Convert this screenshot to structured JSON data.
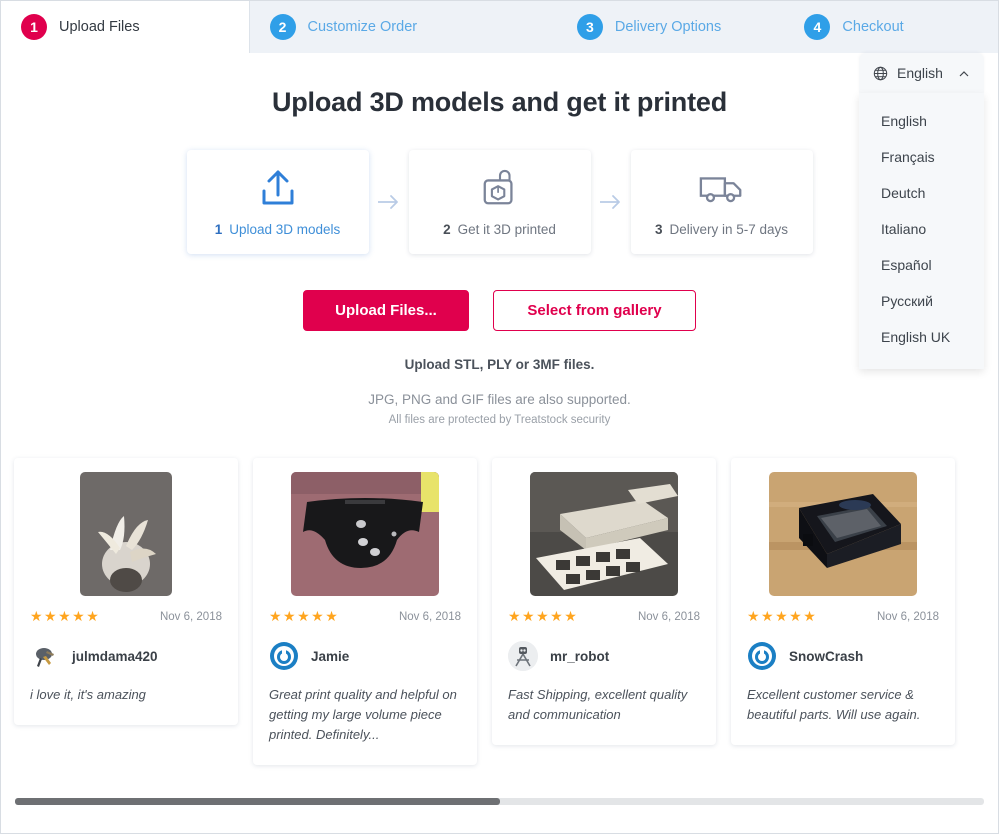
{
  "steps": [
    {
      "num": "1",
      "label": "Upload Files",
      "active": true
    },
    {
      "num": "2",
      "label": "Customize Order",
      "active": false
    },
    {
      "num": "3",
      "label": "Delivery Options",
      "active": false
    },
    {
      "num": "4",
      "label": "Checkout",
      "active": false
    }
  ],
  "language": {
    "selected": "English",
    "globe_icon": "globe-icon",
    "chevron_icon": "chevron-up-icon",
    "options": [
      "English",
      "Français",
      "Deutch",
      "Italiano",
      "Español",
      "Русский",
      "English UK"
    ]
  },
  "main": {
    "title": "Upload 3D models and get it printed",
    "process": [
      {
        "idx": "1",
        "label": "Upload 3D models",
        "icon": "upload-icon",
        "active": true
      },
      {
        "idx": "2",
        "label": "Get it 3D printed",
        "icon": "printer-icon",
        "active": false
      },
      {
        "idx": "3",
        "label": "Delivery in 5-7 days",
        "icon": "truck-icon",
        "active": false
      }
    ],
    "arrow_icon": "arrow-right-icon",
    "upload_button": "Upload Files...",
    "gallery_button": "Select from gallery",
    "hint_formats": "Upload STL, PLY or 3MF files.",
    "hint_images": "JPG, PNG and GIF files are also supported.",
    "hint_security": "All files are protected by Treatstock security"
  },
  "reviews": [
    {
      "stars": "★★★★★",
      "date": "Nov 6, 2018",
      "user": "julmdama420",
      "text": "i love it, it's amazing",
      "photo": "white-3d-printed-flower-photo",
      "avatar": "photo-avatar"
    },
    {
      "stars": "★★★★★",
      "date": "Nov 6, 2018",
      "user": "Jamie",
      "text": "Great print quality and helpful on getting my large volume piece printed. Definitely...",
      "photo": "black-curved-3d-print-on-seat-photo",
      "avatar": "power-logo-avatar"
    },
    {
      "stars": "★★★★★",
      "date": "Nov 6, 2018",
      "user": "mr_robot",
      "text": "Fast Shipping, excellent quality and communication",
      "photo": "white-trays-and-grid-photo",
      "avatar": "robot-avatar"
    },
    {
      "stars": "★★★★★",
      "date": "Nov 6, 2018",
      "user": "SnowCrash",
      "text": "Excellent customer service & beautiful parts. Will use again.",
      "photo": "black-frame-enclosure-photo",
      "avatar": "power-logo-avatar"
    }
  ],
  "scroll": {
    "thumb_percent": "50"
  },
  "colors": {
    "accent_pink": "#e0004d",
    "accent_blue": "#2f9fe8",
    "star_gold": "#ffa51f",
    "tabbar_bg": "#eef2f7"
  }
}
